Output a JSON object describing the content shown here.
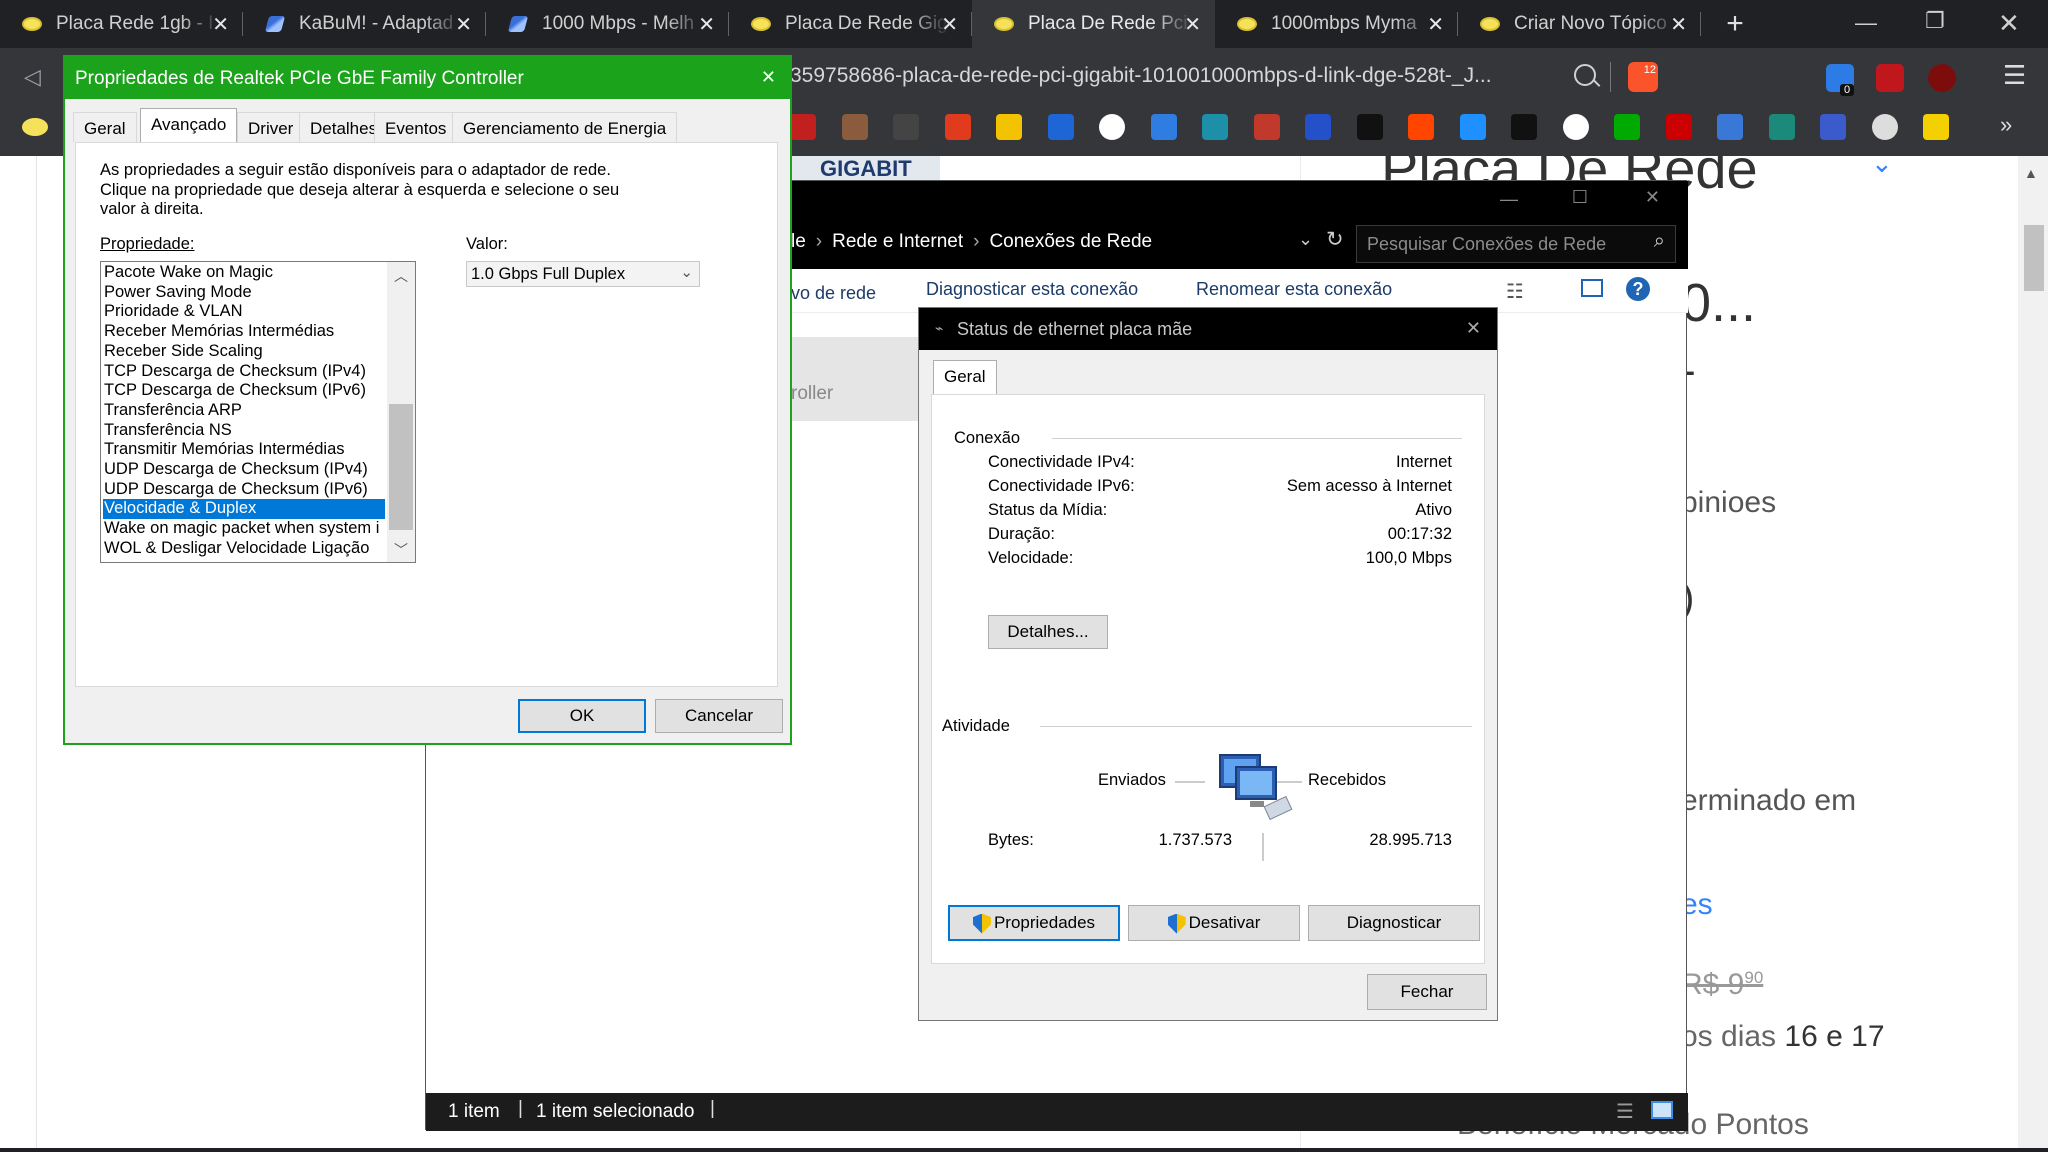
{
  "browser": {
    "tabs": [
      {
        "title": "Placa Rede 1gb - I",
        "fav": "o",
        "active": false
      },
      {
        "title": "KaBuM! - Adaptad",
        "fav": "k",
        "active": false
      },
      {
        "title": "1000 Mbps - Melh",
        "fav": "k",
        "active": false
      },
      {
        "title": "Placa De Rede Gig",
        "fav": "o",
        "active": false
      },
      {
        "title": "Placa De Rede Pci",
        "fav": "o",
        "active": true
      },
      {
        "title": "1000mbps Myma",
        "fav": "o",
        "active": false
      },
      {
        "title": "Criar Novo Tópico",
        "fav": "o",
        "active": false
      }
    ],
    "new_tab": "+",
    "url": "359758686-placa-de-rede-pci-gigabit-101001000mbps-d-link-dge-528t-_J...",
    "brave_badge": "12",
    "ext_badge": "0"
  },
  "page": {
    "partial_banner": "GIGABIT",
    "heading": "Placa De Rede",
    "line_b": "0...",
    "line_c": "-",
    "opinions": "pinioes",
    "paren": ")",
    "ended": "erminado em",
    "link": "es",
    "old_price": "R$ 9",
    "old_cents": "90",
    "days_prefix": "os dias",
    "days_highlight": "16 e 17",
    "benefit": "Benefício Mercado Pontos",
    "explorer_partial_label": "roller",
    "left_partial": "vo de rede"
  },
  "explorer": {
    "breadcrumb": [
      "le",
      "Rede e Internet",
      "Conexões de Rede"
    ],
    "search_placeholder": "Pesquisar Conexões de Rede",
    "ribbon": [
      "Diagnosticar esta conexão",
      "Renomear esta conexão"
    ],
    "status_items": "1 item",
    "status_selected": "1 item selecionado"
  },
  "status_dialog": {
    "title": "Status de ethernet placa mãe",
    "tab": "Geral",
    "connection_group": "Conexão",
    "rows": [
      {
        "label": "Conectividade IPv4:",
        "value": "Internet"
      },
      {
        "label": "Conectividade IPv6:",
        "value": "Sem acesso à Internet"
      },
      {
        "label": "Status da Mídia:",
        "value": "Ativo"
      },
      {
        "label": "Duração:",
        "value": "00:17:32"
      },
      {
        "label": "Velocidade:",
        "value": "100,0 Mbps"
      }
    ],
    "details_button": "Detalhes...",
    "activity_group": "Atividade",
    "sent_label": "Enviados",
    "received_label": "Recebidos",
    "bytes_label": "Bytes:",
    "bytes_sent": "1.737.573",
    "bytes_received": "28.995.713",
    "btn_properties": "Propriedades",
    "btn_disable": "Desativar",
    "btn_diagnose": "Diagnosticar",
    "btn_close": "Fechar"
  },
  "props_dialog": {
    "title": "Propriedades de Realtek PCIe GbE Family Controller",
    "tabs": [
      "Geral",
      "Avançado",
      "Driver",
      "Detalhes",
      "Eventos",
      "Gerenciamento de Energia"
    ],
    "active_tab": "Avançado",
    "description": [
      "As propriedades a seguir estão disponíveis para o adaptador de rede.",
      "Clique na propriedade que deseja alterar à esquerda e selecione o seu",
      "valor à direita."
    ],
    "property_label": "Propriedade:",
    "value_label": "Valor:",
    "properties": [
      "Pacote Wake on Magic",
      "Power Saving Mode",
      "Prioridade & VLAN",
      "Receber Memórias Intermédias",
      "Receber Side Scaling",
      "TCP Descarga de Checksum (IPv4)",
      "TCP Descarga de Checksum (IPv6)",
      "Transferência ARP",
      "Transferência NS",
      "Transmitir Memórias Intermédias",
      "UDP Descarga de Checksum (IPv4)",
      "UDP Descarga de Checksum (IPv6)",
      "Velocidade & Duplex",
      "Wake on magic packet when system i",
      "WOL & Desligar Velocidade Ligação"
    ],
    "selected_property": "Velocidade & Duplex",
    "value_selected": "1.0 Gbps Full Duplex",
    "ok": "OK",
    "cancel": "Cancelar"
  },
  "colors": {
    "accent_green": "#1ba31b",
    "selection_blue": "#0078d7",
    "chrome_dark": "#202124"
  }
}
